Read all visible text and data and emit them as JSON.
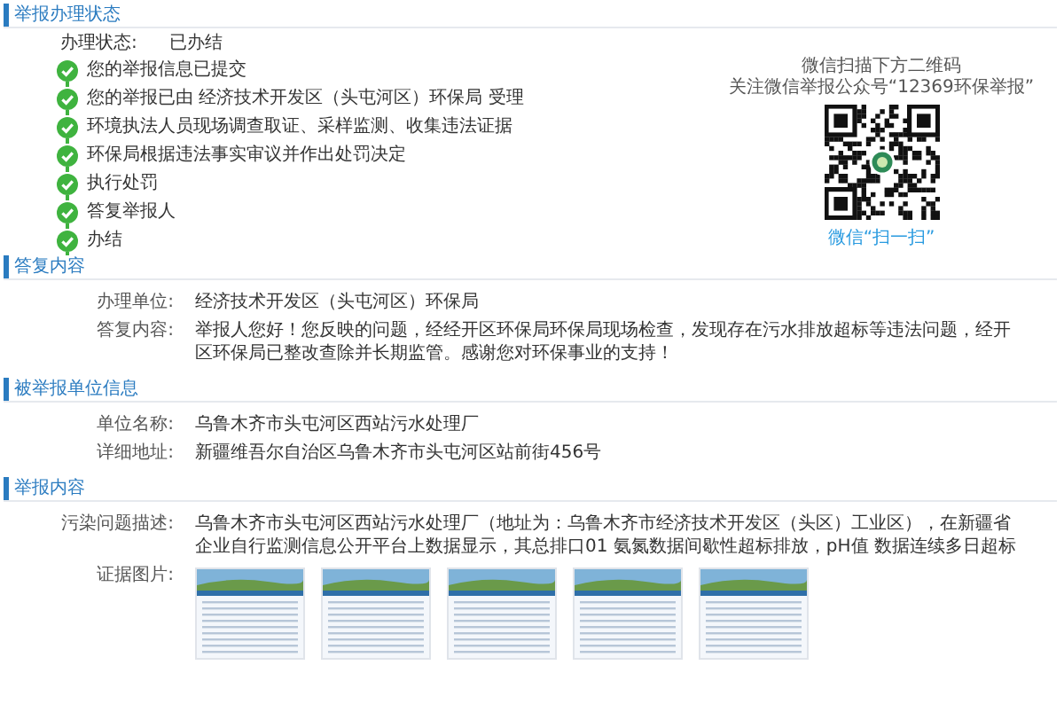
{
  "sections": [
    {
      "title": "举报办理状态",
      "kind": "status",
      "status_label": "办理状态:",
      "status_value": "已办结",
      "steps": [
        {
          "text": "您的举报信息已提交",
          "done": true
        },
        {
          "text": "您的举报已由 经济技术开发区（头屯河区）环保局 受理",
          "done": true
        },
        {
          "text": "环境执法人员现场调查取证、采样监测、收集违法证据",
          "done": true
        },
        {
          "text": "环保局根据违法事实审议并作出处罚决定",
          "done": true
        },
        {
          "text": "执行处罚",
          "done": true
        },
        {
          "text": "答复举报人",
          "done": true
        },
        {
          "text": "办结",
          "done": true
        }
      ],
      "qr": {
        "caption_lines": [
          "微信扫描下方二维码",
          "关注微信举报公众号“12369环保举报”"
        ],
        "scan_label": "微信“扫一扫”"
      }
    },
    {
      "title": "答复内容",
      "kind": "fields",
      "fields": [
        {
          "label": "办理单位:",
          "value": "经济技术开发区（头屯河区）环保局"
        },
        {
          "label": "答复内容:",
          "value": "举报人您好！您反映的问题，经经开区环保局环保局现场检查，发现存在污水排放超标等违法问题，经开区环保局已整改查除并长期监管。感谢您对环保事业的支持！"
        }
      ]
    },
    {
      "title": "被举报单位信息",
      "kind": "fields",
      "fields": [
        {
          "label": "单位名称:",
          "value": "乌鲁木齐市头屯河区西站污水处理厂"
        },
        {
          "label": "详细地址:",
          "value": "新疆维吾尔自治区乌鲁木齐市头屯河区站前街456号"
        }
      ]
    },
    {
      "title": "举报内容",
      "kind": "fields",
      "fields": [
        {
          "label": "污染问题描述:",
          "value": "乌鲁木齐市头屯河区西站污水处理厂（地址为：乌鲁木齐市经济技术开发区（头区）工业区），在新疆省企业自行监测信息公开平台上数据显示，其总排口01 氨氮数据间歇性超标排放，pH值 数据连续多日超标"
        },
        {
          "label": "证据图片:",
          "kind": "images",
          "images": [
            {
              "kind": "screenshot"
            },
            {
              "kind": "screenshot"
            },
            {
              "kind": "screenshot"
            },
            {
              "kind": "screenshot"
            },
            {
              "kind": "screenshot"
            }
          ]
        }
      ]
    }
  ]
}
